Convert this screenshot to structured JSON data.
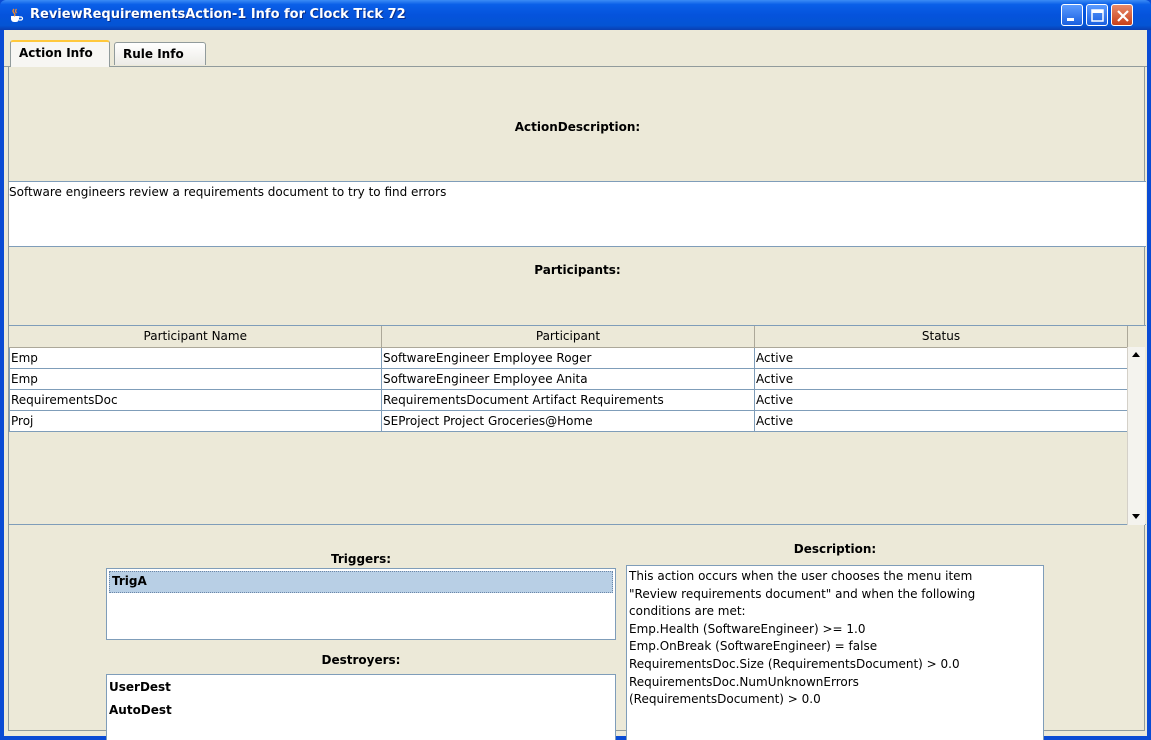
{
  "window": {
    "title": "ReviewRequirementsAction-1 Info for Clock Tick 72"
  },
  "tabs": [
    {
      "label": "Action Info",
      "active": true
    },
    {
      "label": "Rule Info",
      "active": false
    }
  ],
  "action_description": {
    "heading": "ActionDescription:",
    "text": "Software engineers review a requirements document to try to find errors"
  },
  "participants": {
    "heading": "Participants:",
    "columns": [
      "Participant Name",
      "Participant",
      "Status"
    ],
    "rows": [
      [
        "Emp",
        "SoftwareEngineer Employee Roger",
        "Active"
      ],
      [
        "Emp",
        "SoftwareEngineer Employee Anita",
        "Active"
      ],
      [
        "RequirementsDoc",
        "RequirementsDocument Artifact Requirements",
        "Active"
      ],
      [
        "Proj",
        "SEProject Project Groceries@Home",
        "Active"
      ]
    ]
  },
  "triggers": {
    "heading": "Triggers:",
    "items": [
      "TrigA"
    ],
    "selected": "TrigA"
  },
  "destroyers": {
    "heading": "Destroyers:",
    "items": [
      "UserDest",
      "AutoDest"
    ]
  },
  "description": {
    "heading": "Description:",
    "lines": [
      "This action occurs when the user chooses the menu item",
      "\"Review requirements document\" and when the following",
      "conditions are met:",
      "Emp.Health (SoftwareEngineer) >= 1.0",
      "Emp.OnBreak (SoftwareEngineer) = false",
      "RequirementsDoc.Size (RequirementsDocument) > 0.0",
      "RequirementsDoc.NumUnknownErrors",
      "(RequirementsDocument) > 0.0"
    ]
  },
  "icons": {
    "app_icon": "java-coffee-icon",
    "minimize": "minimize-icon",
    "maximize": "maximize-icon",
    "close": "close-icon",
    "scroll_up": "scroll-up-arrow-icon",
    "scroll_down": "scroll-down-arrow-icon"
  }
}
